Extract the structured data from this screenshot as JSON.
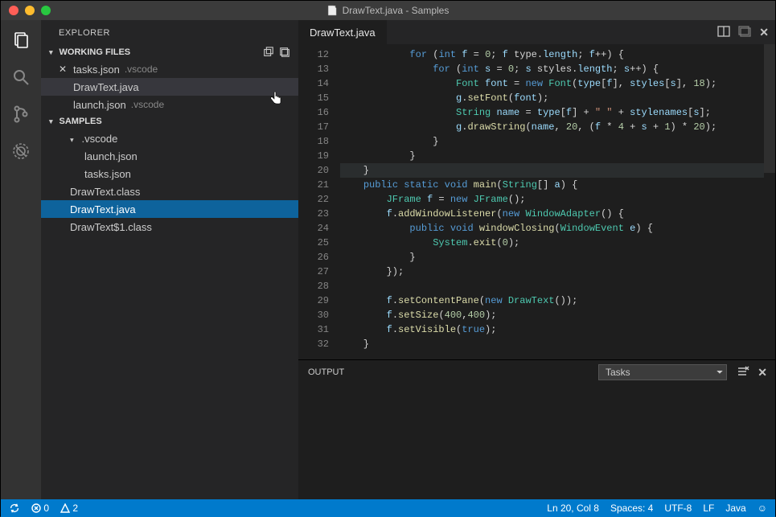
{
  "title": "DrawText.java - Samples",
  "activitybar": {
    "items": [
      "files-icon",
      "search-icon",
      "source-control-icon",
      "debug-icon"
    ]
  },
  "sidebar": {
    "header": "EXPLORER",
    "workingHeader": "WORKING FILES",
    "workingFiles": [
      {
        "name": "tasks.json",
        "dir": ".vscode",
        "dirty": true,
        "active": false
      },
      {
        "name": "DrawText.java",
        "dir": "",
        "dirty": false,
        "active": true
      },
      {
        "name": "launch.json",
        "dir": ".vscode",
        "dirty": false,
        "active": false
      }
    ],
    "projectHeader": "SAMPLES",
    "tree": [
      {
        "label": ".vscode",
        "kind": "folder",
        "depth": 0
      },
      {
        "label": "launch.json",
        "kind": "file",
        "depth": 1
      },
      {
        "label": "tasks.json",
        "kind": "file",
        "depth": 1
      },
      {
        "label": "DrawText.class",
        "kind": "file",
        "depth": 0
      },
      {
        "label": "DrawText.java",
        "kind": "file",
        "depth": 0,
        "selected": true
      },
      {
        "label": "DrawText$1.class",
        "kind": "file",
        "depth": 0
      }
    ]
  },
  "editor": {
    "tab": "DrawText.java",
    "firstLine": 12,
    "highlightLine": 20,
    "lines": [
      "            <k>for</k> (<k>int</k> <v>f</v> = <n>0</n>; <v>f</v> < <v>type</v>.<v>length</v>; <v>f</v>++) {",
      "                <k>for</k> (<k>int</k> <v>s</v> = <n>0</n>; <v>s</v> < <v>styles</v>.<v>length</v>; <v>s</v>++) {",
      "                    <t>Font</t> <v>font</v> = <k>new</k> <t>Font</t>(<v>type</v>[<v>f</v>], <v>styles</v>[<v>s</v>], <n>18</n>);",
      "                    <v>g</v>.<m>setFont</m>(<v>font</v>);",
      "                    <t>String</t> <v>name</v> = <v>type</v>[<v>f</v>] + <s>\" \"</s> + <v>stylenames</v>[<v>s</v>];",
      "                    <v>g</v>.<m>drawString</m>(<v>name</v>, <n>20</n>, (<v>f</v> * <n>4</n> + <v>s</v> + <n>1</n>) * <n>20</n>);",
      "                }",
      "            }",
      "    }",
      "    <k>public</k> <k>static</k> <k>void</k> <m>main</m>(<t>String</t>[] <v>a</v>) {",
      "        <t>JFrame</t> <v>f</v> = <k>new</k> <t>JFrame</t>();",
      "        <v>f</v>.<m>addWindowListener</m>(<k>new</k> <t>WindowAdapter</t>() {",
      "            <k>public</k> <k>void</k> <m>windowClosing</m>(<t>WindowEvent</t> <v>e</v>) {",
      "                <t>System</t>.<m>exit</m>(<n>0</n>);",
      "            }",
      "        });",
      "",
      "        <v>f</v>.<m>setContentPane</m>(<k>new</k> <t>DrawText</t>());",
      "        <v>f</v>.<m>setSize</m>(<n>400</n>,<n>400</n>);",
      "        <v>f</v>.<m>setVisible</m>(<k>true</k>);",
      "    }"
    ]
  },
  "panel": {
    "title": "OUTPUT",
    "selector": "Tasks"
  },
  "status": {
    "sync": "↻",
    "errors": "0",
    "warnings": "2",
    "lncol": "Ln 20, Col 8",
    "spaces": "Spaces: 4",
    "encoding": "UTF-8",
    "eol": "LF",
    "lang": "Java",
    "smile": "☺"
  }
}
